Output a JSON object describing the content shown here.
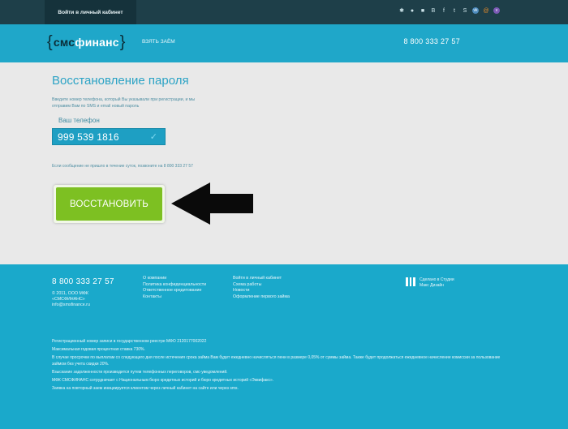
{
  "topbar": {
    "login_label": "Войти в личный кабинет",
    "social_icons": [
      "android-icon",
      "apple-icon",
      "windows-icon",
      "blogger-icon",
      "facebook-icon",
      "twitter-icon",
      "skype-icon",
      "vk-icon",
      "mail-icon",
      "viber-icon"
    ]
  },
  "header": {
    "logo_left_bracket": "{",
    "logo_sms": "смс",
    "logo_finance": "финанс",
    "logo_right_bracket": "}",
    "nav_loan": "взять заём",
    "phone": "8 800 333 27 57"
  },
  "main": {
    "title": "Восстановление пароля",
    "instructions": "Введите номер телефона, который Вы указывали при регистрации, и мы отправим Вам по SMS и email новый пароль",
    "phone_label": "Ваш телефон",
    "phone_value": "999 539 1816",
    "check_glyph": "✓",
    "sms_note": "Если сообщение не пришло в течение суток, позвоните на 8 800 333 27 57",
    "restore_label": "ВОССТАНОВИТЬ"
  },
  "footer": {
    "phone": "8 800 333 27 57",
    "copyright": [
      "© 2011, ООО МФК",
      "«СМСФИНАНС»",
      "info@smsfinance.ru"
    ],
    "col1": [
      "О компании",
      "Политика конфиденциальности",
      "Ответственное кредитование",
      "Контакты"
    ],
    "col2": [
      "Войти в личный кабинет",
      "Схема работы",
      "Новости",
      "Оформление первого займа"
    ],
    "studio": [
      "Сделано в Студии",
      "Макс Дизайн"
    ],
    "legal": [
      "Регистрационный номер записи в государственном реестре МФО 2120177002022",
      "Максимальная годовая процентная ставка 730%.",
      "В случае просрочки по выплатам со следующего дня после истечения срока займа Вам будет ежедневно начисляться пени в размере 0,05% от суммы займа. Также будет продолжаться ежедневное начисление комиссии за пользование займом без учета скидки 20%.",
      "Взыскание задолженности производится путем телефонных переговоров, смс-уведомлений.",
      "МФК СМСФИНАНС сотрудничает с Национальным бюро кредитных историй и бюро кредитных историй «Эквифакс».",
      "Заявка на повторный заем инициируется клиентом через личный кабинет на сайте или через sms."
    ]
  },
  "colors": {
    "topbar": "#1e3f49",
    "header": "#1fa7c9",
    "footer": "#1aa9cb",
    "accent_green": "#7dc022",
    "title_blue": "#2ca3c5"
  }
}
